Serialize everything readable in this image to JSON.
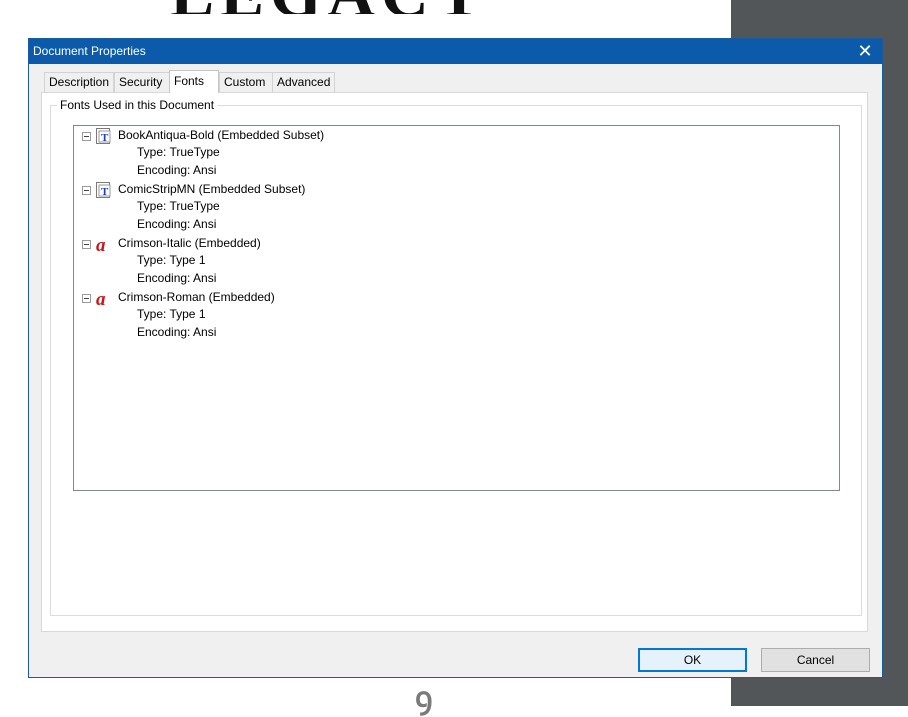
{
  "background": {
    "heading": "LEGACY"
  },
  "dialog": {
    "title": "Document Properties",
    "close_icon": "close-icon",
    "tabs": [
      {
        "label": "Description"
      },
      {
        "label": "Security"
      },
      {
        "label": "Fonts",
        "selected": true
      },
      {
        "label": "Custom"
      },
      {
        "label": "Advanced"
      }
    ],
    "fonts_group": {
      "legend": "Fonts Used in this Document",
      "fonts": [
        {
          "name": "BookAntiqua-Bold (Embedded Subset)",
          "icon": "truetype-font-icon",
          "type": "Type: TrueType",
          "encoding": "Encoding: Ansi"
        },
        {
          "name": "ComicStripMN (Embedded Subset)",
          "icon": "truetype-font-icon",
          "type": "Type: TrueType",
          "encoding": "Encoding: Ansi"
        },
        {
          "name": "Crimson-Italic (Embedded)",
          "icon": "type1-font-icon",
          "type": "Type: Type 1",
          "encoding": "Encoding: Ansi"
        },
        {
          "name": "Crimson-Roman (Embedded)",
          "icon": "type1-font-icon",
          "type": "Type: Type 1",
          "encoding": "Encoding: Ansi"
        }
      ]
    },
    "buttons": {
      "ok": "OK",
      "cancel": "Cancel"
    }
  }
}
